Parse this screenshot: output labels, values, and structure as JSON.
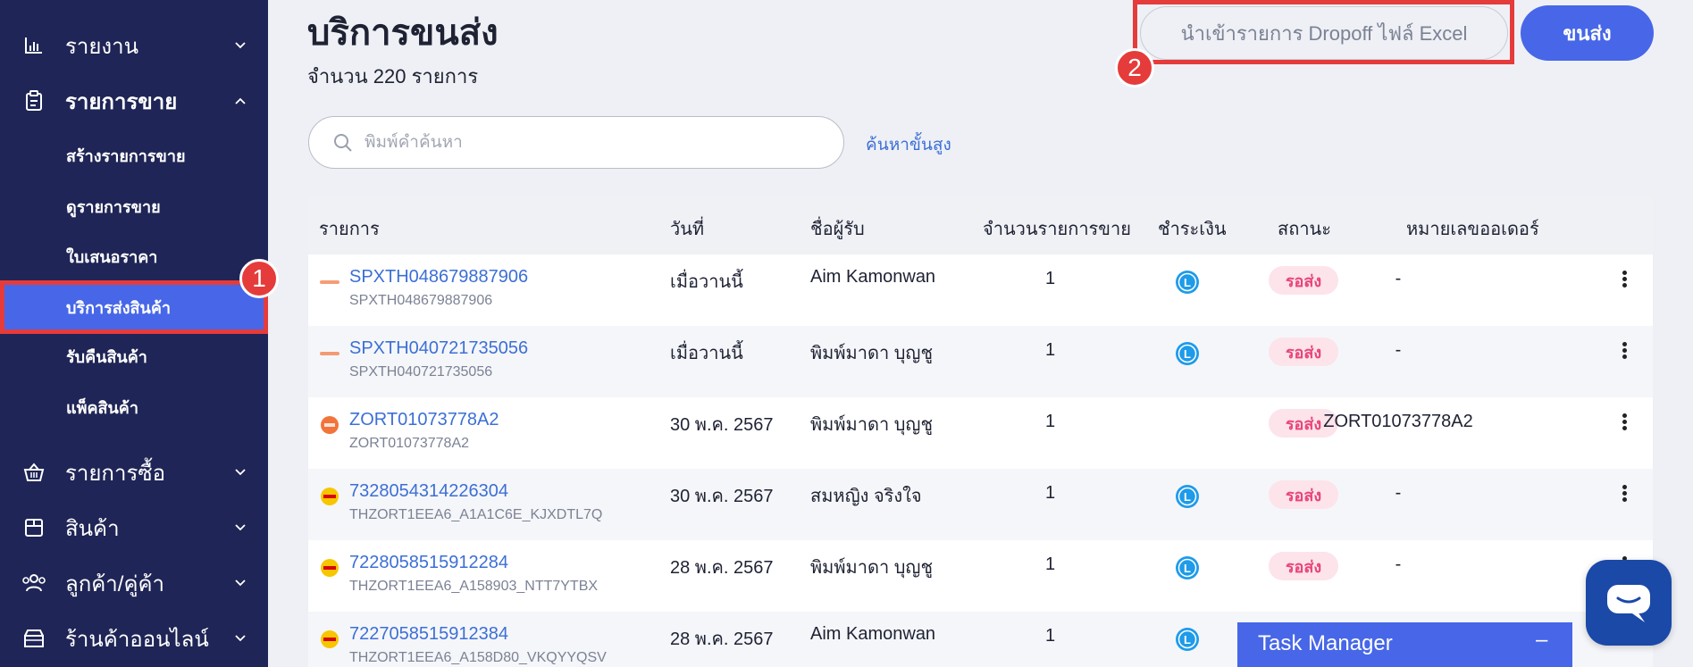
{
  "sidebar": {
    "groups": [
      {
        "label": "รายงาน",
        "icon": "bar-chart-icon"
      },
      {
        "label": "รายการขาย",
        "icon": "clipboard-icon"
      },
      {
        "label": "รายการซื้อ",
        "icon": "basket-icon"
      },
      {
        "label": "สินค้า",
        "icon": "box-icon"
      },
      {
        "label": "ลูกค้า/คู่ค้า",
        "icon": "people-icon"
      },
      {
        "label": "ร้านค้าออนไลน์",
        "icon": "store-icon"
      }
    ],
    "sales_items": [
      {
        "label": "สร้างรายการขาย"
      },
      {
        "label": "ดูรายการขาย"
      },
      {
        "label": "ใบเสนอราคา"
      },
      {
        "label": "บริการส่งสินค้า"
      },
      {
        "label": "รับคืนสินค้า"
      },
      {
        "label": "แพ็คสินค้า"
      }
    ]
  },
  "annotations": {
    "marker1": "1",
    "marker2": "2"
  },
  "header": {
    "title": "บริการขนส่ง",
    "count_text": "จำนวน 220 รายการ",
    "import_button": "นำเข้ารายการ Dropoff ไฟล์ Excel",
    "ship_button": "ขนส่ง"
  },
  "search": {
    "placeholder": "พิมพ์คำค้นหา",
    "advanced_link": "ค้นหาขั้นสูง"
  },
  "table": {
    "headers": {
      "item": "รายการ",
      "date": "วันที่",
      "recipient": "ชื่อผู้รับ",
      "qty": "จำนวนรายการขาย",
      "payment": "ชำระเงิน",
      "status": "สถานะ",
      "order_no": "หมายเลขออเดอร์"
    },
    "rows": [
      {
        "carrier": "shopee-express-logo",
        "ref": "SPXTH048679887906",
        "sub": "SPXTH048679887906",
        "date": "เมื่อวานนี้",
        "recipient": "Aim Kamonwan",
        "qty": "1",
        "payment_icon": "payment-l-icon",
        "status": "รอส่ง",
        "order_no": "-"
      },
      {
        "carrier": "shopee-express-logo",
        "ref": "SPXTH040721735056",
        "sub": "SPXTH040721735056",
        "date": "เมื่อวานนี้",
        "recipient": "พิมพ์มาดา บุญชู",
        "qty": "1",
        "payment_icon": "payment-l-icon",
        "status": "รอส่ง",
        "order_no": "-"
      },
      {
        "carrier": "zort-logo",
        "ref": "ZORT01073778A2",
        "sub": "ZORT01073778A2",
        "date": "30 พ.ค. 2567",
        "recipient": "พิมพ์มาดา บุญชู",
        "qty": "1",
        "payment_icon": "",
        "status": "รอส่ง",
        "order_no": "ZORT01073778A2"
      },
      {
        "carrier": "dhl-logo",
        "ref": "7328054314226304",
        "sub": "THZORT1EEA6_A1A1C6E_KJXDTL7Q",
        "date": "30 พ.ค. 2567",
        "recipient": "สมหญิง จริงใจ",
        "qty": "1",
        "payment_icon": "payment-l-icon",
        "status": "รอส่ง",
        "order_no": "-"
      },
      {
        "carrier": "dhl-logo",
        "ref": "7228058515912284",
        "sub": "THZORT1EEA6_A158903_NTT7YTBX",
        "date": "28 พ.ค. 2567",
        "recipient": "พิมพ์มาดา บุญชู",
        "qty": "1",
        "payment_icon": "payment-l-icon",
        "status": "รอส่ง",
        "order_no": "-"
      },
      {
        "carrier": "dhl-logo",
        "ref": "7227058515912384",
        "sub": "THZORT1EEA6_A158D80_VKQYYQSV",
        "date": "28 พ.ค. 2567",
        "recipient": "Aim Kamonwan",
        "qty": "1",
        "payment_icon": "payment-l-icon",
        "status": "",
        "order_no": ""
      }
    ]
  },
  "task_manager": {
    "label": "Task Manager",
    "minimize": "–"
  },
  "colors": {
    "sidebar_bg": "#1f2556",
    "accent": "#4767e8",
    "highlight": "#e53b3b",
    "link": "#3c6fd6",
    "status_bg": "#fde3ea",
    "status_text": "#e8457a",
    "payment": "#1e9be9"
  }
}
